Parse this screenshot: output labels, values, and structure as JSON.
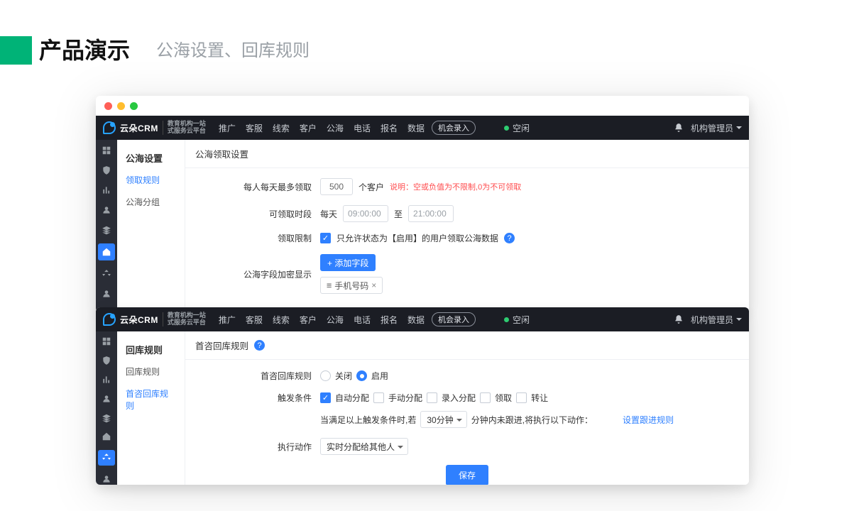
{
  "slide": {
    "title": "产品演示",
    "subtitle": "公海设置、回库规则"
  },
  "brand": {
    "name": "云朵CRM",
    "tag1": "教育机构一站",
    "tag2": "式服务云平台"
  },
  "nav": {
    "items": [
      "推广",
      "客服",
      "线索",
      "客户",
      "公海",
      "电话",
      "报名",
      "数据"
    ],
    "entry_btn": "机会录入",
    "status": "空闲",
    "user": "机构管理员"
  },
  "win1": {
    "side_head": "公海设置",
    "side_items": {
      "a": "领取规则",
      "b": "公海分组"
    },
    "section": "公海领取设置",
    "rows": {
      "r1_label": "每人每天最多领取",
      "r1_value": "500",
      "r1_unit": "个客户",
      "r1_hint": "说明：空或负值为不限制,0为不可领取",
      "r2_label": "可领取时段",
      "r2_prefix": "每天",
      "r2_from": "09:00:00",
      "r2_mid": "至",
      "r2_to": "21:00:00",
      "r3_label": "领取限制",
      "r3_text": "只允许状态为【启用】的用户领取公海数据",
      "r4_label": "公海字段加密显示",
      "r4_btn": "+ 添加字段",
      "r4_tag": "手机号码"
    }
  },
  "win2": {
    "side_head": "回库规则",
    "side_items": {
      "a": "回库规则",
      "b": "首咨回库规则"
    },
    "section": "首咨回库规则",
    "rows": {
      "r1_label": "首咨回库规则",
      "r1_off": "关闭",
      "r1_on": "启用",
      "r2_label": "触发条件",
      "r2_c1": "自动分配",
      "r2_c2": "手动分配",
      "r2_c3": "录入分配",
      "r2_c4": "领取",
      "r2_c5": "转让",
      "r3_pre": "当满足以上触发条件时,若",
      "r3_sel": "30分钟",
      "r3_post": "分钟内未跟进,将执行以下动作：",
      "r3_link": "设置跟进规则",
      "r4_label": "执行动作",
      "r4_sel": "实时分配给其他人",
      "save": "保存"
    }
  }
}
